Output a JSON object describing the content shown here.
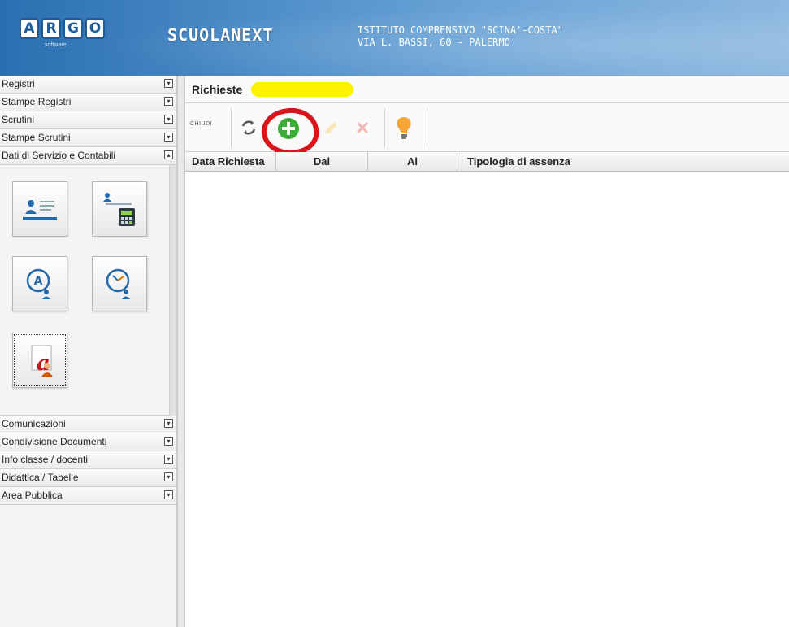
{
  "header": {
    "logo_letters": [
      "A",
      "R",
      "G",
      "O"
    ],
    "logo_subtitle": "software",
    "brand": "SCUOLANEXT",
    "school_name": "ISTITUTO COMPRENSIVO \"SCINA'-COSTA\"",
    "school_address": "VIA L. BASSI, 60 - PALERMO"
  },
  "sidebar": {
    "items_top": [
      {
        "label": "Registri"
      },
      {
        "label": "Stampe Registri"
      },
      {
        "label": "Scrutini"
      },
      {
        "label": "Stampe Scrutini"
      },
      {
        "label": "Dati di Servizio e Contabili"
      }
    ],
    "items_bottom": [
      {
        "label": "Comunicazioni"
      },
      {
        "label": "Condivisione Documenti"
      },
      {
        "label": "Info classe / docenti"
      },
      {
        "label": "Didattica / Tabelle"
      },
      {
        "label": "Area Pubblica"
      }
    ],
    "tiles": [
      {
        "icon": "personal-data-card-icon"
      },
      {
        "icon": "payroll-calculator-icon"
      },
      {
        "icon": "absences-person-icon"
      },
      {
        "icon": "hours-clock-person-icon"
      },
      {
        "icon": "acrobat-document-person-icon"
      }
    ]
  },
  "main": {
    "title": "Richieste",
    "toolbar": {
      "close_label": "CHIUDI",
      "buttons": [
        "refresh-icon",
        "add-icon",
        "edit-icon",
        "delete-icon",
        "lightbulb-icon"
      ]
    },
    "columns": [
      "Data Richiesta",
      "Dal",
      "Al",
      "Tipologia di assenza"
    ]
  },
  "colors": {
    "accent_red": "#d9141b",
    "highlight_yellow": "#fff200",
    "add_green": "#3cab3a",
    "header_blue": "#2a6fb0"
  }
}
